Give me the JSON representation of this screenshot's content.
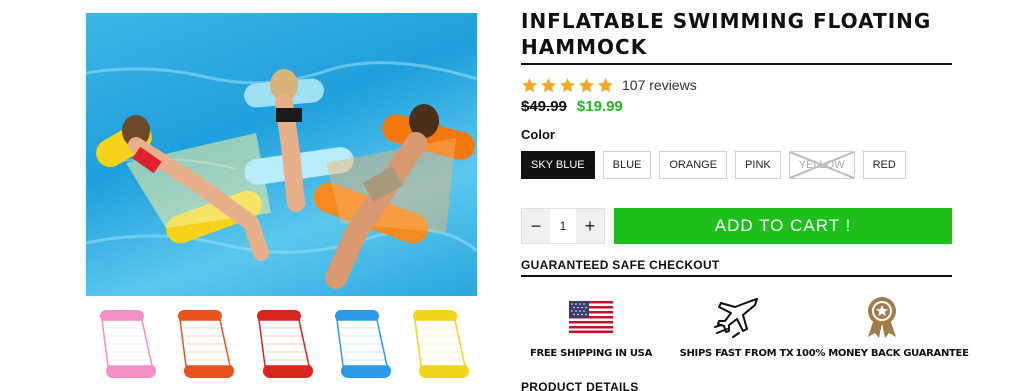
{
  "product": {
    "title": "INFLATABLE SWIMMING FLOATING HAMMOCK",
    "rating": 5,
    "reviews": "107 reviews",
    "old_price": "$49.99",
    "new_price": "$19.99"
  },
  "colors": {
    "label": "Color",
    "options": [
      "SKY BLUE",
      "BLUE",
      "ORANGE",
      "PINK",
      "YELLOW",
      "RED"
    ],
    "selected": "SKY BLUE",
    "unavailable": [
      "YELLOW"
    ]
  },
  "thumbnails": [
    {
      "name": "pink",
      "color": "#f28fc6"
    },
    {
      "name": "orange",
      "color": "#e8521c"
    },
    {
      "name": "red",
      "color": "#d8261e"
    },
    {
      "name": "blue",
      "color": "#2b9ae8"
    },
    {
      "name": "yellow",
      "color": "#f2d41a"
    }
  ],
  "cart": {
    "quantity": "1",
    "minus": "−",
    "plus": "+",
    "add_label": "ADD TO CART !"
  },
  "checkout": {
    "title": "GUARANTEED SAFE CHECKOUT",
    "badges": [
      {
        "label": "FREE SHIPPING IN USA",
        "icon": "us-flag-icon"
      },
      {
        "label": "SHIPS FAST FROM TX",
        "icon": "airplane-icon"
      },
      {
        "label": "100% MONEY BACK GUARANTEE",
        "icon": "award-ribbon-icon"
      }
    ]
  },
  "details": {
    "title": "PRODUCT DETAILS"
  },
  "theme": {
    "accent_green": "#1cbf1c",
    "price_green": "#1fb81f",
    "star": "#f5a623"
  }
}
